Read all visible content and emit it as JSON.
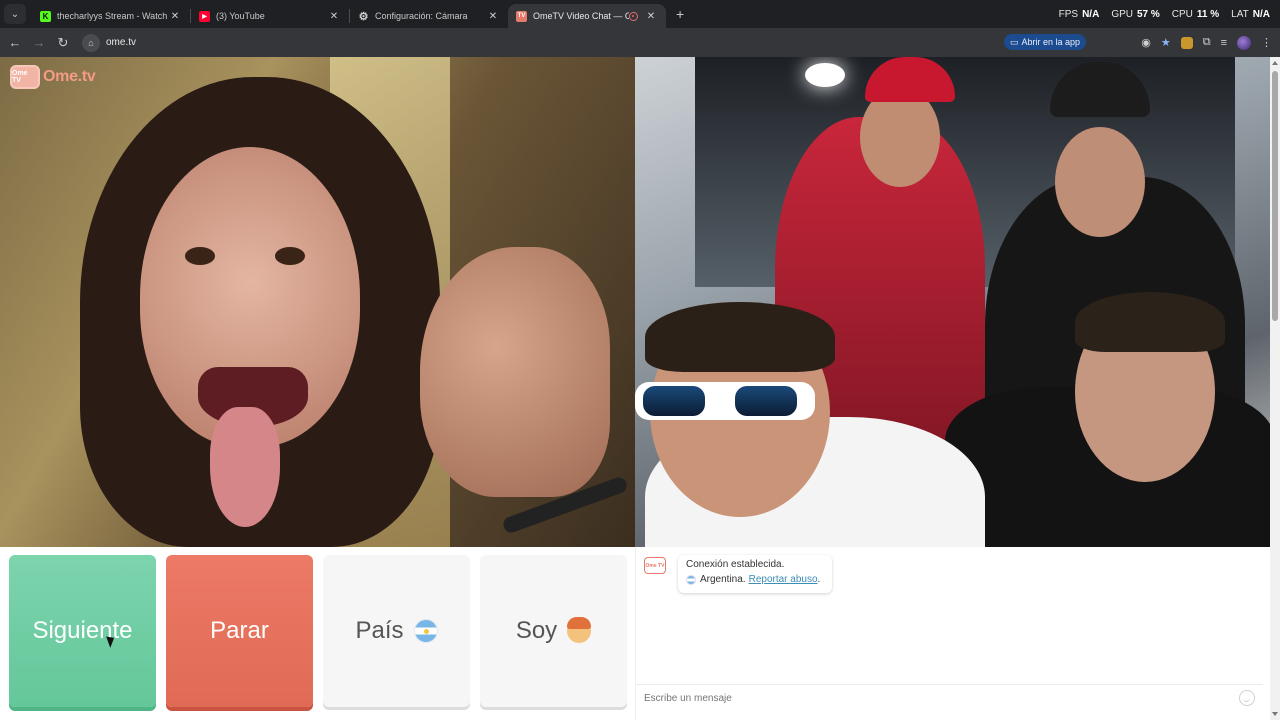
{
  "browser": {
    "tabs": [
      {
        "title": "thecharlyys Stream - Watch Live",
        "icon": "kick-icon",
        "color": "#53fc18"
      },
      {
        "title": "(3) YouTube",
        "icon": "youtube-icon",
        "color": "#ff0033"
      },
      {
        "title": "Configuración: Cámara",
        "icon": "gear-icon",
        "color": "#cfcfcf"
      },
      {
        "title": "OmeTV Video Chat — Omegle",
        "icon": "ometv-icon",
        "color": "#e57a6a",
        "active": true
      }
    ],
    "new_tab_label": "+",
    "perf": {
      "fps_label": "FPS",
      "fps_value": "N/A",
      "gpu_label": "GPU",
      "gpu_value": "57 %",
      "cpu_label": "CPU",
      "cpu_value": "11 %",
      "lat_label": "LAT",
      "lat_value": "N/A"
    },
    "address": "ome.tv",
    "open_in_app": "Abrir en la app"
  },
  "logo": {
    "badge": "Ome TV",
    "text": "Ome.tv"
  },
  "controls": {
    "next_label": "Siguiente",
    "stop_label": "Parar",
    "country_label": "País",
    "gender_label": "Soy"
  },
  "chat": {
    "badge": "Ome TV",
    "status": "Conexión establecida.",
    "country": "Argentina.",
    "report_link": "Reportar abuso",
    "report_suffix": ".",
    "input_placeholder": "Escribe un mensaje"
  }
}
